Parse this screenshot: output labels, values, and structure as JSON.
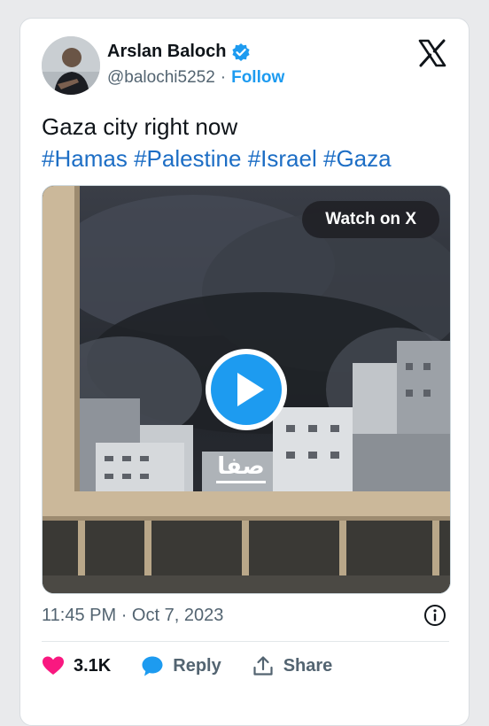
{
  "author": {
    "name": "Arslan Baloch",
    "handle": "@balochi5252",
    "separator": "·",
    "follow_label": "Follow"
  },
  "tweet": {
    "text": "Gaza city right now",
    "hashtags": [
      "#Hamas",
      "#Palestine",
      "#Israel",
      "#Gaza"
    ]
  },
  "media": {
    "watch_label": "Watch on X",
    "watermark_text": "صفا"
  },
  "meta": {
    "time": "11:45 PM",
    "separator": "·",
    "date": "Oct 7, 2023"
  },
  "actions": {
    "likes": "3.1K",
    "reply_label": "Reply",
    "share_label": "Share"
  },
  "icons": {
    "verified": "verified-badge-icon",
    "x_logo": "x-logo-icon",
    "play": "play-icon",
    "info": "info-icon",
    "heart": "heart-icon",
    "reply": "reply-bubble-icon",
    "share": "share-icon"
  },
  "colors": {
    "accent_blue": "#1d9bf0",
    "hashtag_blue": "#1d6ec5",
    "like_pink": "#f91880",
    "text_dark": "#0f1419",
    "text_gray": "#536471"
  }
}
